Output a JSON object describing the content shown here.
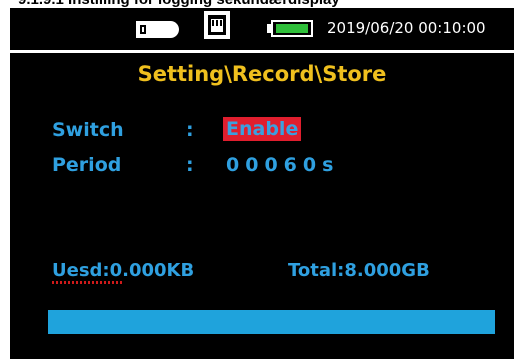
{
  "document": {
    "heading": "9.1.9.1 Instilling for logging sekundærdisplay"
  },
  "status_bar": {
    "usb_icon": "usb-stick-icon",
    "sd_icon": "sd-card-icon",
    "battery_icon": "battery-icon",
    "battery_level": 0.85,
    "datetime": "2019/06/20 00:10:00"
  },
  "screen": {
    "title": "Setting\\Record\\Store",
    "switch": {
      "label": "Switch",
      "separator": ":",
      "value": "Enable"
    },
    "period": {
      "label": "Period",
      "separator": ":",
      "value": "00060s"
    },
    "storage": {
      "used": "Uesd:0.000KB",
      "total": "Total:8.000GB",
      "progress_fraction": 1.0
    }
  },
  "colors": {
    "screen_bg": "#000000",
    "title": "#f0c01e",
    "text_blue": "#2fa0e0",
    "highlight_red": "#e01e2e",
    "battery_green": "#2fbf3a",
    "progress_blue": "#1fa3dc"
  }
}
